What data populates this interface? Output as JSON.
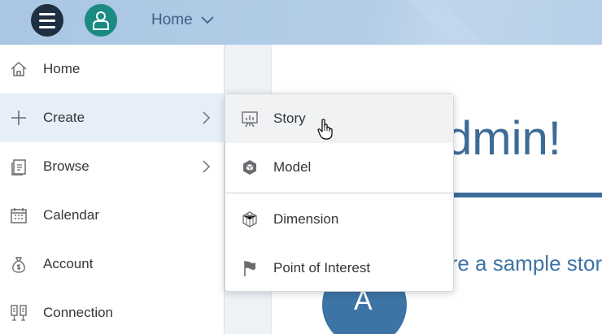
{
  "shellbar": {
    "menu_icon": "hamburger-icon",
    "avatar_icon": "user-icon",
    "home_label": "Home"
  },
  "content": {
    "welcome": "dmin!",
    "explore": "plore a sample story",
    "circle_letter": "A"
  },
  "sidenav": {
    "items": [
      {
        "label": "Home",
        "icon": "home-icon"
      },
      {
        "label": "Create",
        "icon": "add-icon",
        "active": true
      },
      {
        "label": "Browse",
        "icon": "browse-icon"
      },
      {
        "label": "Calendar",
        "icon": "calendar-icon"
      },
      {
        "label": "Account",
        "icon": "money-bag-icon"
      },
      {
        "label": "Connection",
        "icon": "connection-icon"
      }
    ]
  },
  "create_menu": {
    "items": [
      {
        "label": "Story",
        "icon": "story-icon"
      },
      {
        "label": "Model",
        "icon": "model-icon"
      },
      {
        "label": "Dimension",
        "icon": "dimension-icon"
      },
      {
        "label": "Point of Interest",
        "icon": "flag-icon"
      }
    ]
  },
  "colors": {
    "shellbar": "#b3cde6",
    "accent": "#3d6b97",
    "menu_button": "#1e2f41",
    "avatar": "#1a8a82"
  }
}
